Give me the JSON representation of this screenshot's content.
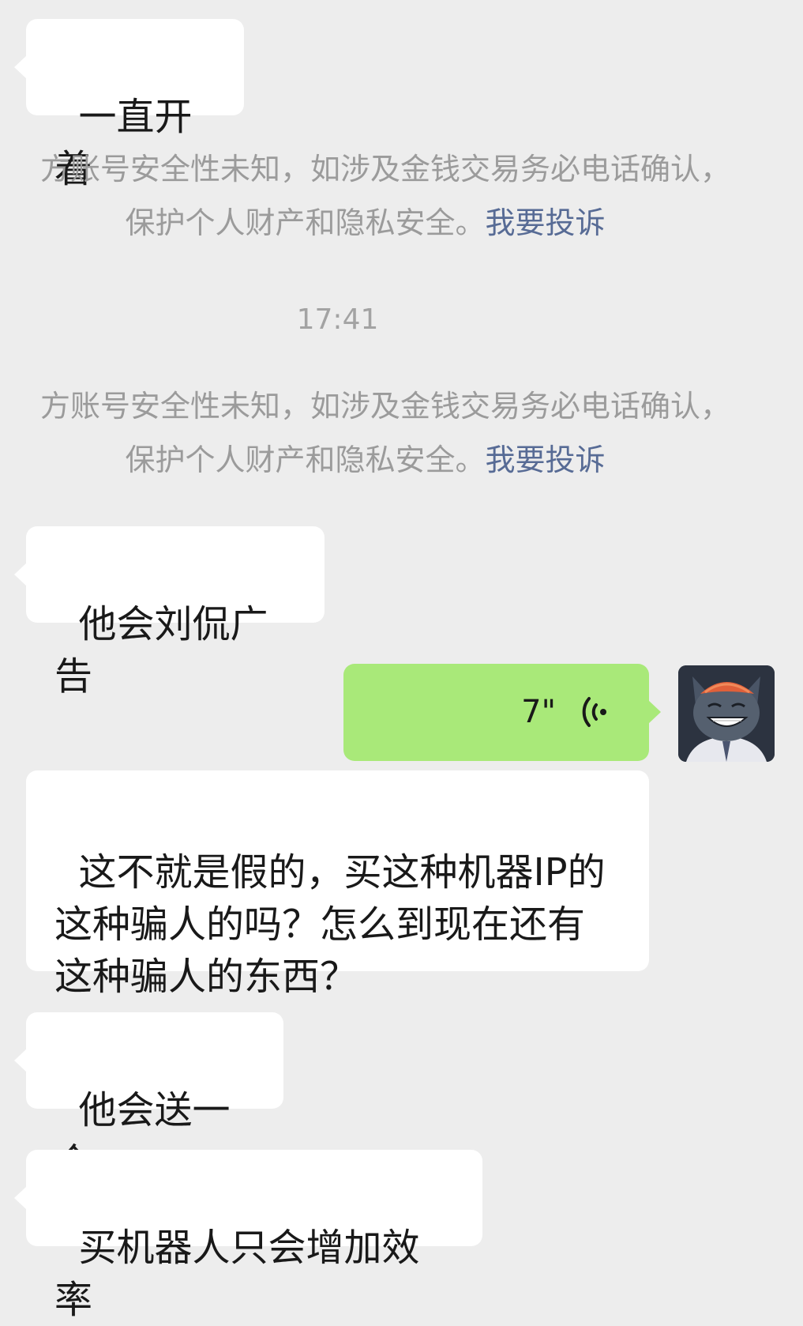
{
  "messages": {
    "m1": "一直开着",
    "m2": "他会刘侃广告",
    "voice_duration": "7\"",
    "m3": "这不就是假的，买这种机器IP的\n这种骗人的吗？怎么到现在还有\n这种骗人的东西？",
    "m4": "他会送一个",
    "m5": "买机器人只会增加效率"
  },
  "notice": {
    "line1": "方账号安全性未知，如涉及金钱交易务必电话确认，",
    "line2": "保护个人财产和隐私安全。",
    "link": "我要投诉"
  },
  "timestamp": "17:41",
  "colors": {
    "background": "#ededed",
    "incoming_bubble": "#ffffff",
    "outgoing_bubble": "#a9e979",
    "link": "#576b95",
    "system_text": "#9b9b9b"
  }
}
